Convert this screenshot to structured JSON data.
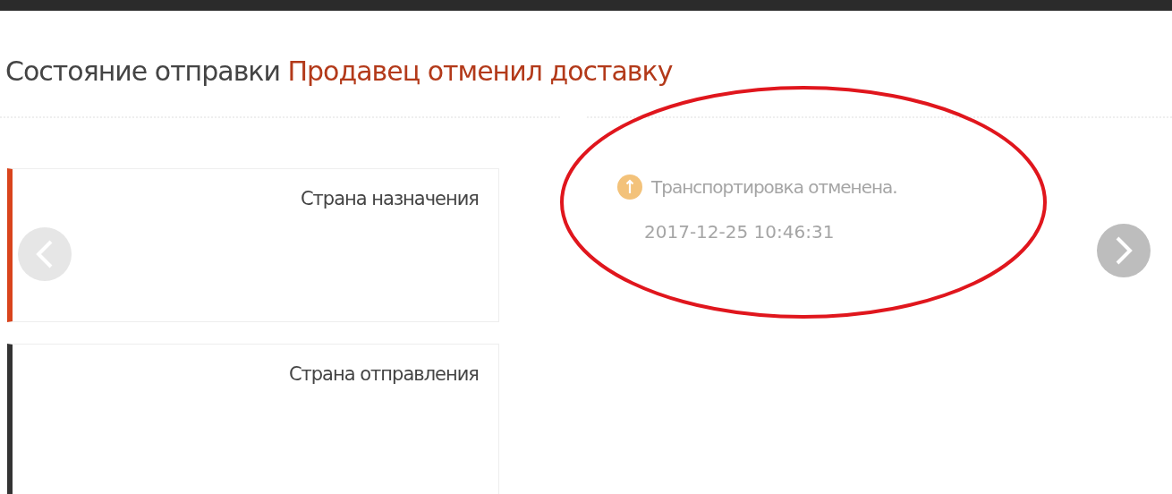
{
  "status": {
    "label": "Состояние отправки",
    "value": "Продавец отменил доставку"
  },
  "route": [
    {
      "label": "Страна назначения",
      "color": "#d9441c"
    },
    {
      "label": "Страна отправления",
      "color": "#333333"
    }
  ],
  "events": [
    {
      "text": "Транспортировка отменена.",
      "time": "2017-12-25 10:46:31"
    }
  ],
  "annotation": {
    "kind": "ellipse",
    "color": "#e0161d"
  }
}
